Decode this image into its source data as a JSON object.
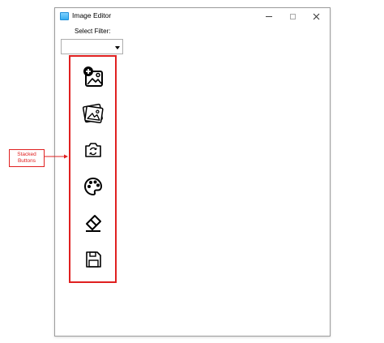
{
  "window": {
    "title": "Image Editor",
    "controls": {
      "minimize": "minimize",
      "maximize": "maximize",
      "close": "close"
    }
  },
  "filter": {
    "label": "Select Filter:",
    "value": ""
  },
  "toolbar": {
    "buttons": [
      {
        "icon": "add-image-icon"
      },
      {
        "icon": "gallery-icon"
      },
      {
        "icon": "rotate-image-icon"
      },
      {
        "icon": "palette-icon"
      },
      {
        "icon": "eraser-icon"
      },
      {
        "icon": "save-icon"
      }
    ]
  },
  "annotation": {
    "text": "Stacked\nButtons",
    "color": "#e02020"
  }
}
